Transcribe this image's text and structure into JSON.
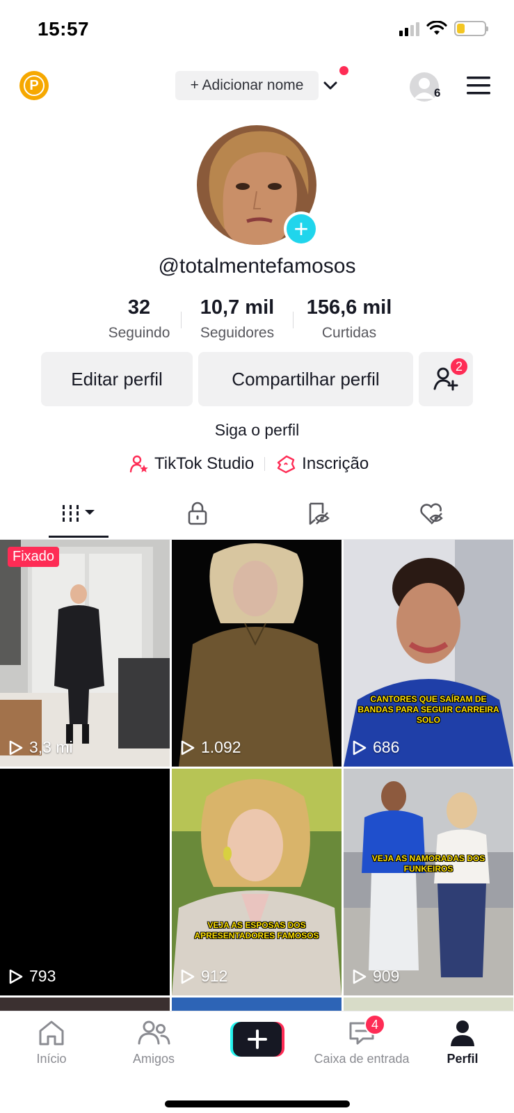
{
  "status_bar": {
    "time": "15:57",
    "battery_color": "#f3c623"
  },
  "header": {
    "badge_letter": "P",
    "add_name_label": "+ Adicionar nome",
    "account_count": "6",
    "accent": "#fe2c55"
  },
  "profile": {
    "username": "@totalmentefamosos",
    "stats": [
      {
        "value": "32",
        "label": "Seguindo"
      },
      {
        "value": "10,7 mil",
        "label": "Seguidores"
      },
      {
        "value": "156,6 mil",
        "label": "Curtidas"
      }
    ],
    "edit_button": "Editar perfil",
    "share_button": "Compartilhar perfil",
    "friends_badge": "2",
    "follow_text": "Siga o perfil",
    "links": [
      {
        "icon": "person-star-icon",
        "label": "TikTok Studio"
      },
      {
        "icon": "ticket-icon",
        "label": "Inscrição"
      }
    ]
  },
  "tabs": [
    {
      "name": "videos-grid-icon",
      "active": true
    },
    {
      "name": "lock-icon",
      "active": false
    },
    {
      "name": "bookmark-hidden-icon",
      "active": false
    },
    {
      "name": "heart-hidden-icon",
      "active": false
    }
  ],
  "videos": [
    {
      "views": "3,3 mi",
      "pinned_label": "Fixado",
      "caption": ""
    },
    {
      "views": "1.092",
      "pinned_label": "",
      "caption": ""
    },
    {
      "views": "686",
      "pinned_label": "",
      "caption": "CANTORES QUE SAÍRAM DE BANDAS PARA SEGUIR CARREIRA SOLO"
    },
    {
      "views": "793",
      "pinned_label": "",
      "caption": ""
    },
    {
      "views": "912",
      "pinned_label": "",
      "caption": "VEJA AS ESPOSAS DOS APRESENTADORES FAMOSOS"
    },
    {
      "views": "909",
      "pinned_label": "",
      "caption": "VEJA AS NAMORADAS DOS FUNKEIROS"
    }
  ],
  "bottom_nav": {
    "items": [
      {
        "icon": "home-icon",
        "label": "Início"
      },
      {
        "icon": "friends-icon",
        "label": "Amigos"
      },
      {
        "icon": "create-icon",
        "label": ""
      },
      {
        "icon": "inbox-icon",
        "label": "Caixa de entrada"
      },
      {
        "icon": "profile-icon",
        "label": "Perfil"
      }
    ],
    "inbox_badge": "4"
  }
}
